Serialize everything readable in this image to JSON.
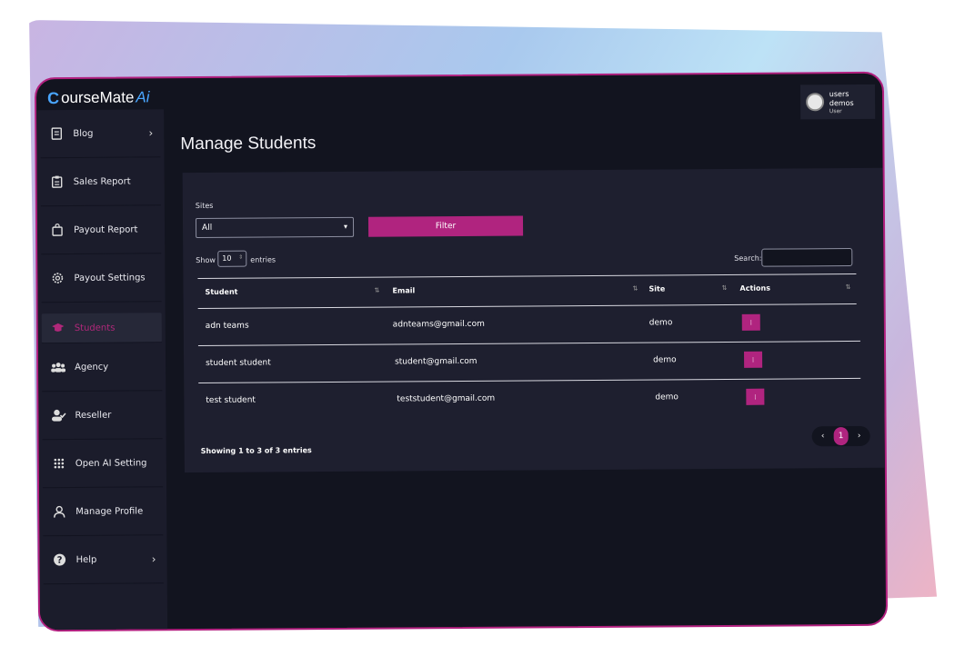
{
  "logo": {
    "mark": "C",
    "text": "ourseMate",
    "ai": "Ai"
  },
  "user": {
    "name": "users demos",
    "role": "User"
  },
  "page_title": "Manage Students",
  "sidebar": {
    "items": [
      {
        "label": "Blog",
        "icon": "document-icon",
        "chevron": "›"
      },
      {
        "label": "Sales Report",
        "icon": "clipboard-icon"
      },
      {
        "label": "Payout Report",
        "icon": "shopping-bag-icon"
      },
      {
        "label": "Payout Settings",
        "icon": "gear-icon"
      },
      {
        "label": "Students",
        "icon": "graduation-cap-icon",
        "active": true
      },
      {
        "label": "Agency",
        "icon": "users-group-icon"
      },
      {
        "label": "Reseller",
        "icon": "user-check-icon"
      },
      {
        "label": "Open AI Setting",
        "icon": "grid-dots-icon"
      },
      {
        "label": "Manage Profile",
        "icon": "user-outline-icon"
      },
      {
        "label": "Help",
        "icon": "help-circle-icon",
        "chevron": "›"
      }
    ]
  },
  "filters": {
    "sites_label": "Sites",
    "sites_value": "All",
    "filter_button": "Filter"
  },
  "table_controls": {
    "show_label": "Show",
    "entries_value": "10",
    "entries_label": "entries",
    "search_label": "Search:"
  },
  "table": {
    "columns": [
      "Student",
      "Email",
      "Site",
      "Actions"
    ],
    "rows": [
      {
        "student": "adn teams",
        "email": "adnteams@gmail.com",
        "site": "demo",
        "action": "⁝"
      },
      {
        "student": "student student",
        "email": "student@gmail.com",
        "site": "demo",
        "action": "⁝"
      },
      {
        "student": "test student",
        "email": "teststudent@gmail.com",
        "site": "demo",
        "action": "⁝"
      }
    ]
  },
  "footer": {
    "info": "Showing 1 to 3 of 3 entries",
    "prev": "‹",
    "page": "1",
    "next": "›"
  },
  "colors": {
    "accent": "#b0247f",
    "bg": "#12141f",
    "sidebar": "#1b1c2b",
    "card": "#1e1f2f"
  }
}
